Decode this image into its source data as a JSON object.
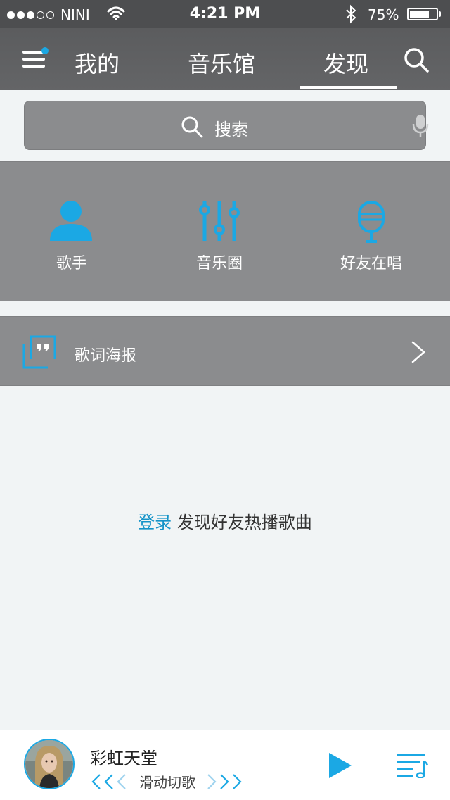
{
  "status_bar": {
    "carrier": "NINI",
    "time": "4:21 PM",
    "battery": "75%",
    "battery_level": 0.75
  },
  "nav": {
    "tabs": [
      "我的",
      "音乐馆",
      "发现"
    ],
    "active_tab": "发现"
  },
  "search": {
    "placeholder": "搜索"
  },
  "shortcuts": [
    {
      "label": "歌手",
      "icon": "singer-icon"
    },
    {
      "label": "音乐圈",
      "icon": "equalizer-icon"
    },
    {
      "label": "好友在唱",
      "icon": "microphone-icon"
    }
  ],
  "poster": {
    "label": "歌词海报",
    "icon": "quote-icon"
  },
  "empty": {
    "login": "登录",
    "text": " 发现好友热播歌曲"
  },
  "player": {
    "song": "彩虹天堂",
    "hint": "滑动切歌"
  },
  "colors": {
    "accent": "#1ba8e4",
    "nav_bg": "#5b5c5e",
    "panel_bg": "#8b8c8e",
    "page_bg": "#f1f4f5",
    "login_link": "#1493c8"
  }
}
